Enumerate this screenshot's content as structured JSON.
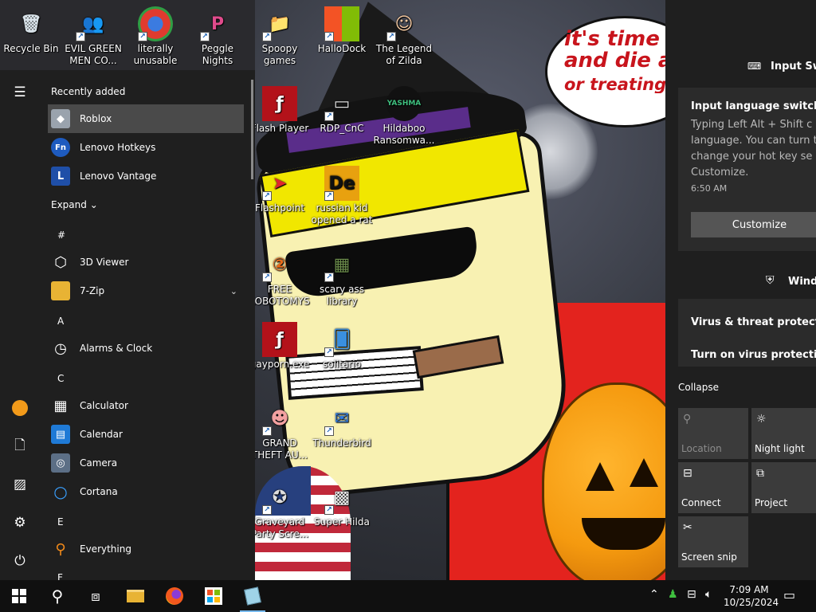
{
  "desktop": {
    "bubble_text": {
      "line1": "it's time t",
      "line2": "and die a",
      "line3": "or treating"
    },
    "icons": [
      {
        "label": "Recycle Bin",
        "glyph": "🗑",
        "shortcut": false
      },
      {
        "label": "EVIL GREEN MEN CO...",
        "glyph": "👥",
        "shortcut": true
      },
      {
        "label": "literally unusable",
        "glyph": "◉",
        "shortcut": true
      },
      {
        "label": "Peggle Nights Deluxe",
        "glyph": "P",
        "shortcut": true
      },
      {
        "label": "Spoopy games",
        "glyph": "📁",
        "shortcut": true
      },
      {
        "label": "HalloDock",
        "glyph": "⊞",
        "shortcut": true
      },
      {
        "label": "The Legend of Zilda",
        "glyph": "☺",
        "shortcut": true
      },
      {
        "label": "Flash Player",
        "glyph": "ƒ",
        "shortcut": false
      },
      {
        "label": "RDP_CnC",
        "glyph": "▭",
        "shortcut": true
      },
      {
        "label": "Hildaboo Ransomwa...",
        "glyph": "YASHMA",
        "shortcut": false
      },
      {
        "label": "Flashpoint",
        "glyph": "➤",
        "shortcut": true
      },
      {
        "label": "russian kid opened a rat",
        "glyph": "De",
        "shortcut": true
      },
      {
        "label": "FREE LOBOTOMYS",
        "glyph": "②",
        "shortcut": true
      },
      {
        "label": "scary ass library",
        "glyph": "▦",
        "shortcut": true
      },
      {
        "label": "gayporn.exe",
        "glyph": "ƒ",
        "shortcut": false
      },
      {
        "label": "solitario",
        "glyph": "🂠",
        "shortcut": true
      },
      {
        "label": "GRAND THEFT AU...",
        "glyph": "☻",
        "shortcut": true
      },
      {
        "label": "Thunderbird",
        "glyph": "✉",
        "shortcut": true
      },
      {
        "label": "Graveyard Party Scre...",
        "glyph": "✪",
        "shortcut": true
      },
      {
        "label": "Super Hilda",
        "glyph": "▩",
        "shortcut": true
      }
    ]
  },
  "start_menu": {
    "recently_added_label": "Recently added",
    "expand_label": "Expand",
    "letters": {
      "hash": "#",
      "a": "A",
      "c": "C",
      "e": "E",
      "f": "F"
    },
    "apps": [
      {
        "label": "Roblox",
        "glyph": "◆",
        "color": "#9aa3ad"
      },
      {
        "label": "Lenovo Hotkeys",
        "glyph": "Fn",
        "color": "#1e5bbf"
      },
      {
        "label": "Lenovo Vantage",
        "glyph": "L",
        "color": "#1f4fa8"
      },
      {
        "label": "3D Viewer",
        "glyph": "⬡",
        "color": "#1f1f1f"
      },
      {
        "label": "7-Zip",
        "glyph": "▬",
        "color": "#e8b334"
      },
      {
        "label": "Alarms & Clock",
        "glyph": "◷",
        "color": "#1f1f1f"
      },
      {
        "label": "Calculator",
        "glyph": "▦",
        "color": "#1f1f1f"
      },
      {
        "label": "Calendar",
        "glyph": "▤",
        "color": "#1f7ad6"
      },
      {
        "label": "Camera",
        "glyph": "◎",
        "color": "#5c6f86"
      },
      {
        "label": "Cortana",
        "glyph": "○",
        "color": "#1f1f1f"
      },
      {
        "label": "Everything",
        "glyph": "⚲",
        "color": "#1f1f1f"
      }
    ]
  },
  "action_center": {
    "input_switch_head": "Input Swi",
    "notification": {
      "title": "Input language switchin",
      "body_line1": "Typing Left Alt + Shift c",
      "body_line2": "language. You can turn t",
      "body_line3": "change your hot key se",
      "body_line4": "Customize.",
      "time": "6:50 AM",
      "button_label": "Customize"
    },
    "windows_head": "Windo",
    "security": {
      "title": "Virus & threat protectio",
      "subtitle": "Turn on virus protection"
    },
    "collapse_label": "Collapse",
    "tiles": [
      {
        "label": "Location",
        "glyph": "⚲",
        "disabled": true
      },
      {
        "label": "Night light",
        "glyph": "☼",
        "disabled": false
      },
      {
        "label": "Connect",
        "glyph": "⊟",
        "disabled": false
      },
      {
        "label": "Project",
        "glyph": "⧉",
        "disabled": false
      },
      {
        "label": "Screen snip",
        "glyph": "✂",
        "disabled": false
      }
    ]
  },
  "taskbar": {
    "time": "7:09 AM",
    "date": "10/25/2024"
  }
}
